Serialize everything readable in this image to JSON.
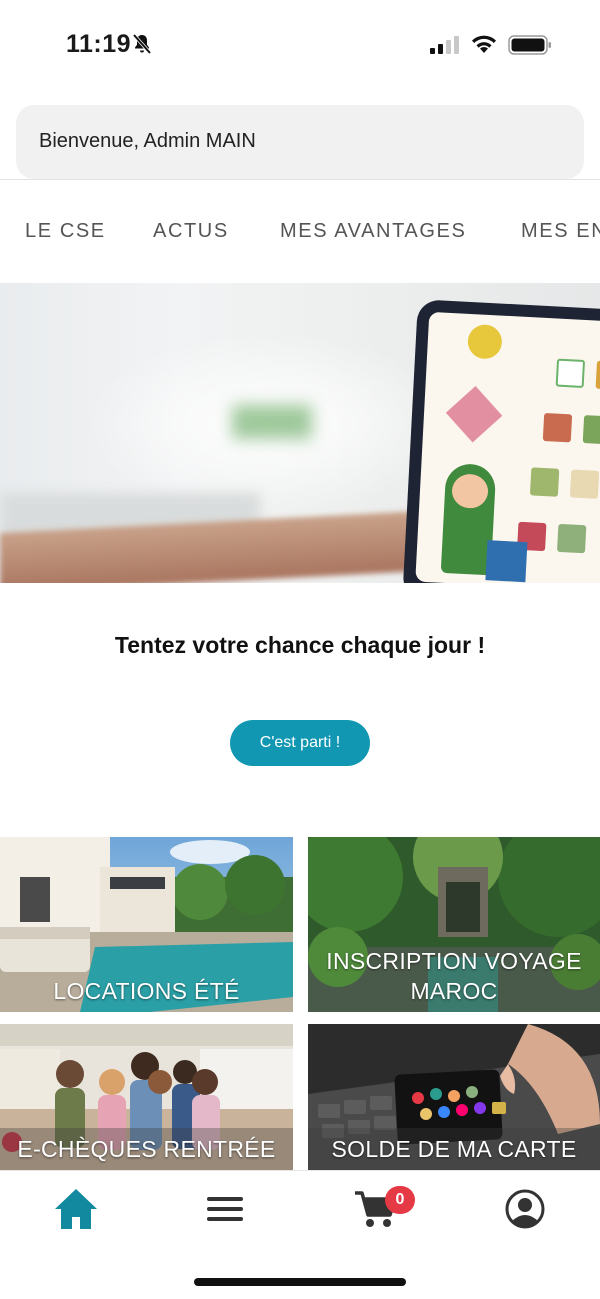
{
  "status_bar": {
    "time": "11:19"
  },
  "header": {
    "welcome_text": "Bienvenue, Admin MAIN"
  },
  "tabs": [
    {
      "label": "LE CSE"
    },
    {
      "label": "ACTUS"
    },
    {
      "label": "MES AVANTAGES"
    },
    {
      "label": "MES EN"
    }
  ],
  "promo": {
    "title": "Tentez votre chance chaque jour !",
    "button_label": "C'est parti !"
  },
  "tiles": [
    {
      "label": "LOCATIONS ÉTÉ"
    },
    {
      "label": "INSCRIPTION VOYAGE MAROC"
    },
    {
      "label": "E-CHÈQUES RENTRÉE"
    },
    {
      "label": "SOLDE DE MA CARTE"
    }
  ],
  "bottom_nav": {
    "items": [
      {
        "icon": "home-icon"
      },
      {
        "icon": "menu-icon"
      },
      {
        "icon": "cart-icon"
      },
      {
        "icon": "account-icon"
      }
    ],
    "cart_count": "0"
  },
  "colors": {
    "accent": "#1297b3",
    "home_active": "#12899f",
    "badge": "#e63946"
  }
}
